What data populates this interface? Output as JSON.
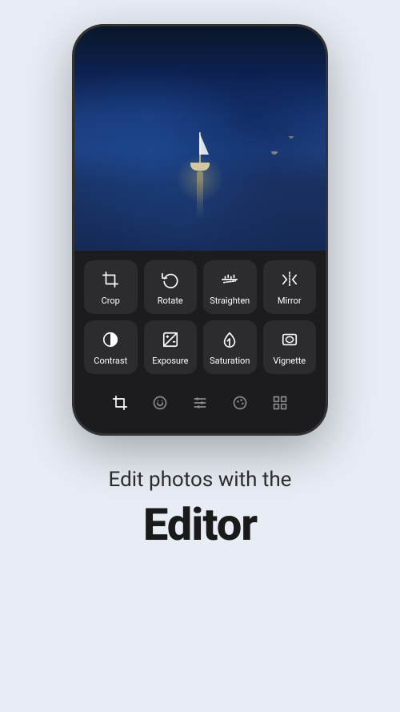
{
  "phone": {
    "tools_row1": [
      {
        "id": "crop",
        "label": "Crop",
        "icon": "crop"
      },
      {
        "id": "rotate",
        "label": "Rotate",
        "icon": "rotate"
      },
      {
        "id": "straighten",
        "label": "Straighten",
        "icon": "straighten"
      },
      {
        "id": "mirror",
        "label": "Mirror",
        "icon": "mirror"
      }
    ],
    "tools_row2": [
      {
        "id": "contrast",
        "label": "Contrast",
        "icon": "contrast"
      },
      {
        "id": "exposure",
        "label": "Exposure",
        "icon": "exposure"
      },
      {
        "id": "saturation",
        "label": "Saturation",
        "icon": "saturation"
      },
      {
        "id": "vignette",
        "label": "Vignette",
        "icon": "vignette"
      }
    ],
    "nav_icons": [
      "crop-nav",
      "mask-nav",
      "adjust-nav",
      "palette-nav",
      "grid-nav"
    ]
  },
  "text": {
    "subtitle": "Edit photos with the",
    "main_title": "Editor"
  }
}
